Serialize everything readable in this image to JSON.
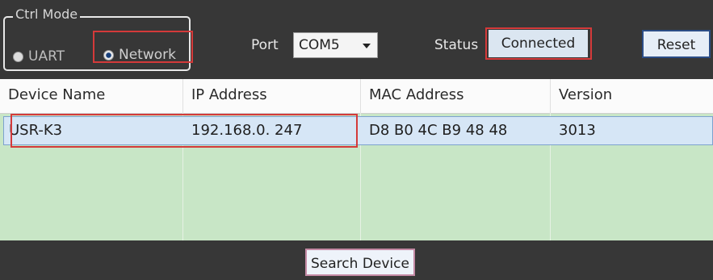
{
  "toolbar": {
    "ctrl_mode_label": "Ctrl Mode",
    "mode_options": [
      {
        "label": "UART",
        "selected": false
      },
      {
        "label": "Network",
        "selected": true
      }
    ],
    "port_label": "Port",
    "port_value": "COM5",
    "status_label": "Status",
    "status_value": "Connected",
    "reset_label": "Reset"
  },
  "table": {
    "columns": [
      "Device Name",
      "IP Address",
      "MAC Address",
      "Version"
    ],
    "rows": [
      {
        "device_name": "USR-K3",
        "ip_address": "192.168.0. 247",
        "mac_address": "D8 B0 4C B9 48 48",
        "version": "3013"
      }
    ]
  },
  "footer": {
    "search_label": "Search Device"
  },
  "colors": {
    "toolbar_bg": "#373737",
    "grid_bg": "#c8e6c6",
    "highlight_red": "#d43a3a",
    "selected_row": "#d6e6f6"
  }
}
